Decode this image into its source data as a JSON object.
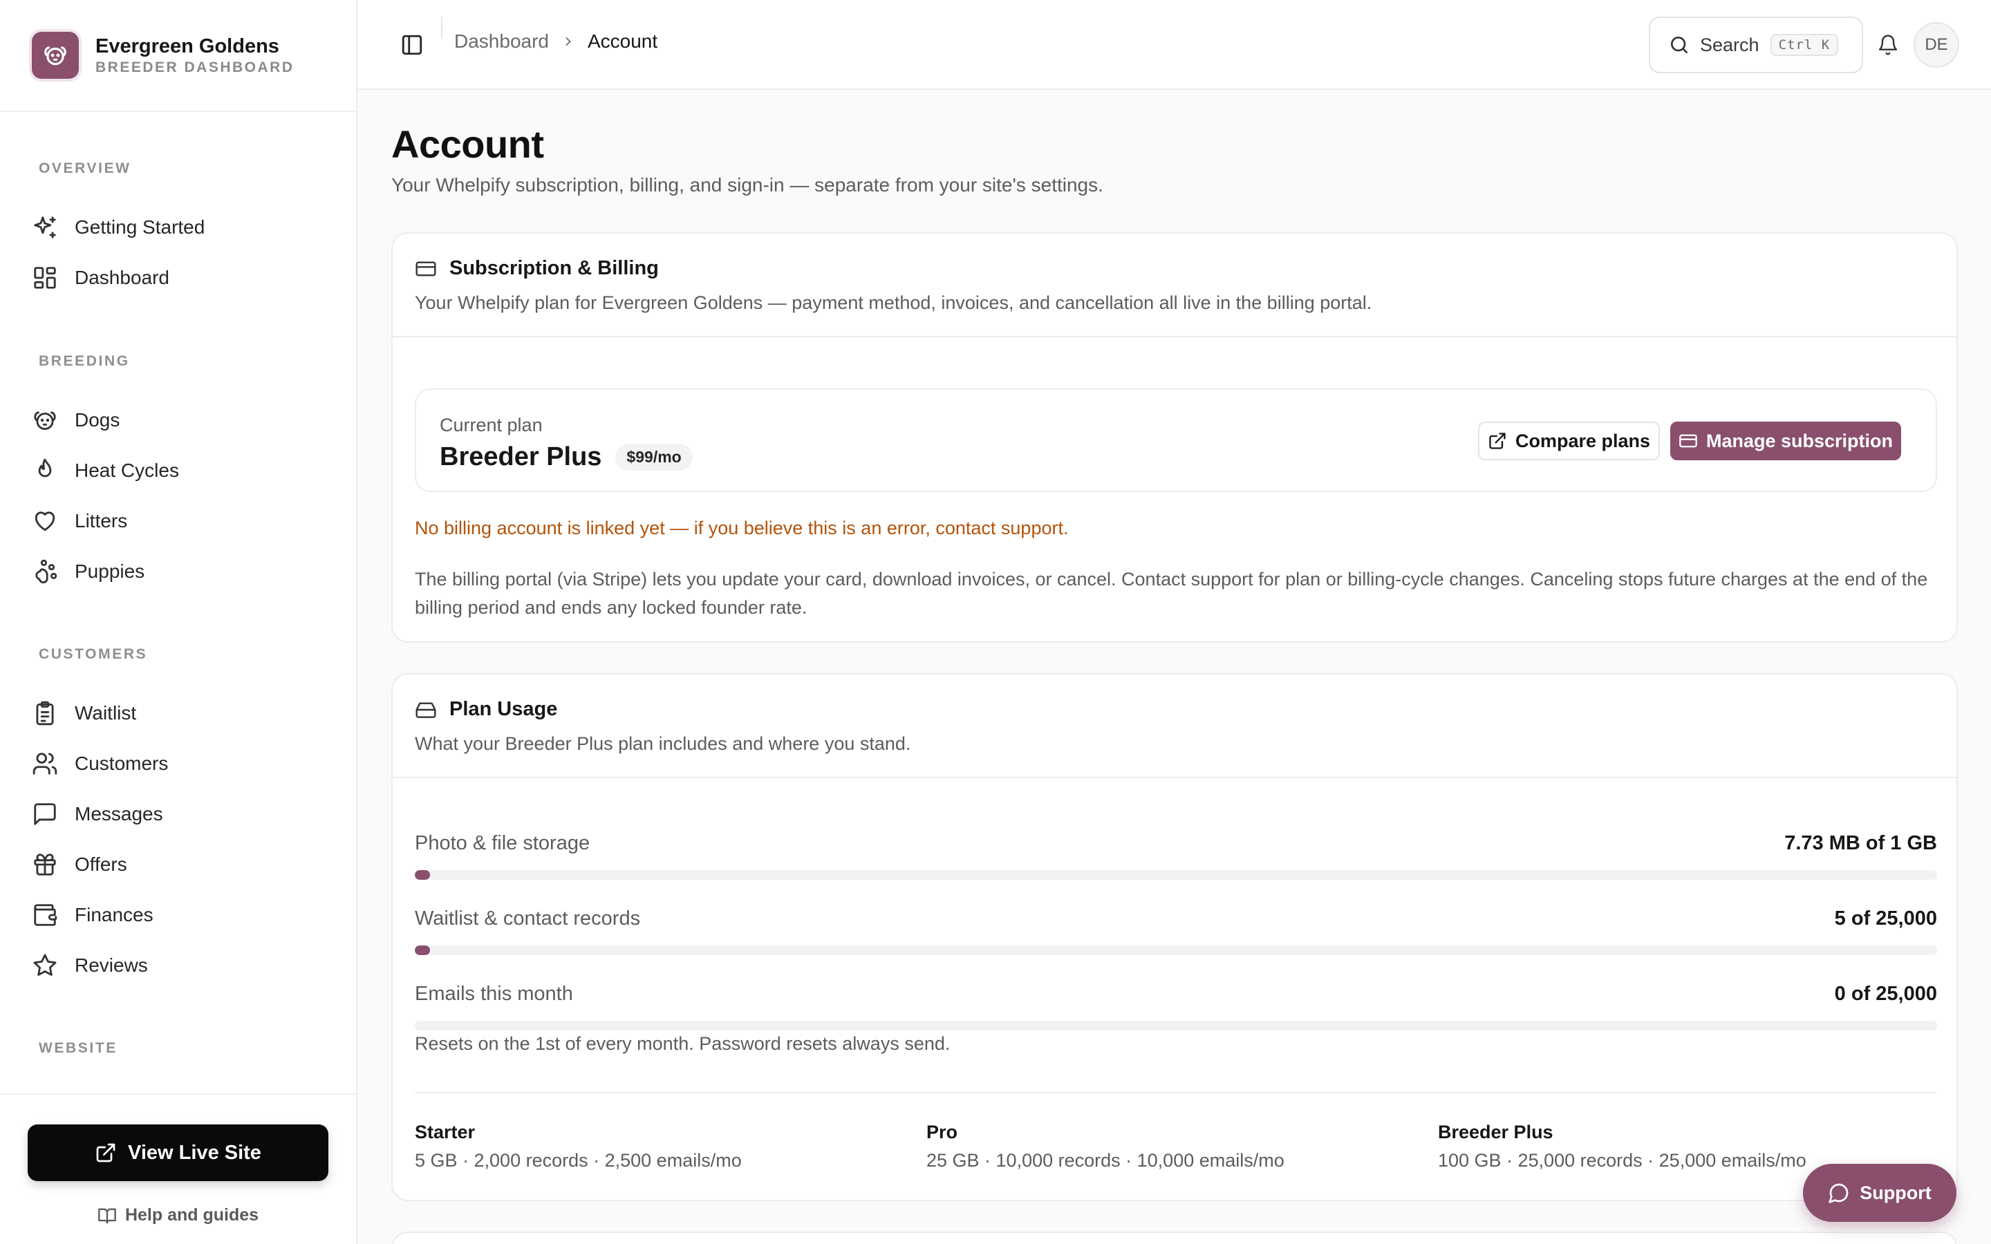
{
  "brand": {
    "name": "Evergreen Goldens",
    "subtitle": "BREEDER DASHBOARD"
  },
  "sidebar": {
    "sections": {
      "overview": "OVERVIEW",
      "breeding": "BREEDING",
      "customers": "CUSTOMERS",
      "website": "WEBSITE"
    },
    "items": {
      "getting_started": "Getting Started",
      "dashboard": "Dashboard",
      "dogs": "Dogs",
      "heat_cycles": "Heat Cycles",
      "litters": "Litters",
      "puppies": "Puppies",
      "waitlist": "Waitlist",
      "customers": "Customers",
      "messages": "Messages",
      "offers": "Offers",
      "finances": "Finances",
      "reviews": "Reviews"
    },
    "view_live_site": "View Live Site",
    "help": "Help and guides"
  },
  "topbar": {
    "breadcrumb": [
      "Dashboard",
      "Account"
    ],
    "search_label": "Search",
    "search_shortcut": "Ctrl K",
    "avatar_initials": "DE"
  },
  "page": {
    "title": "Account",
    "subtitle": "Your Whelpify subscription, billing, and sign-in — separate from your site's settings."
  },
  "billing": {
    "title": "Subscription & Billing",
    "description": "Your Whelpify plan for Evergreen Goldens — payment method, invoices, and cancellation all live in the billing portal.",
    "current_plan_label": "Current plan",
    "plan_name": "Breeder Plus",
    "price": "$99/mo",
    "compare_button": "Compare plans",
    "manage_button": "Manage subscription",
    "warning": "No billing account is linked yet — if you believe this is an error, contact support.",
    "info": "The billing portal (via Stripe) lets you update your card, download invoices, or cancel. Contact support for plan or billing-cycle changes. Canceling stops future charges at the end of the billing period and ends any locked founder rate."
  },
  "usage": {
    "title": "Plan Usage",
    "description": "What your Breeder Plus plan includes and where you stand.",
    "rows": [
      {
        "label": "Photo & file storage",
        "value": "7.73 MB of 1 GB",
        "fraction": 0.0076
      },
      {
        "label": "Waitlist & contact records",
        "value": "5 of 25,000",
        "fraction": 0.0002
      },
      {
        "label": "Emails this month",
        "value": "0 of 25,000",
        "fraction": 0
      }
    ],
    "reset_note": "Resets on the 1st of every month. Password resets always send.",
    "tiers": [
      {
        "name": "Starter",
        "detail": "5 GB · 2,000 records · 2,500 emails/mo"
      },
      {
        "name": "Pro",
        "detail": "25 GB · 10,000 records · 10,000 emails/mo"
      },
      {
        "name": "Breeder Plus",
        "detail": "100 GB · 25,000 records · 25,000 emails/mo"
      }
    ]
  },
  "support_button": "Support",
  "colors": {
    "accent": "#8a4f6d",
    "warning": "#b45309"
  }
}
